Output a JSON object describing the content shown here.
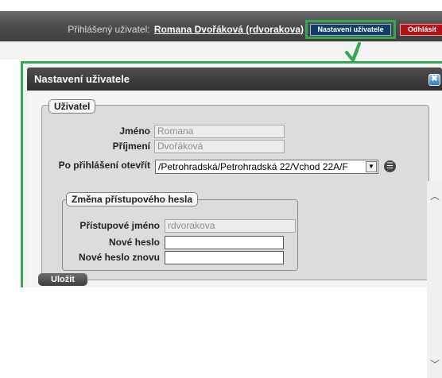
{
  "header": {
    "logged_in_label": "Přihlášený uživatel:",
    "user_display": "Romana Dvořáková (rdvorakova)",
    "settings_button": "Nastavení uživatele",
    "logout_button": "Odhlásit"
  },
  "dialog": {
    "title": "Nastavení uživatele",
    "close_icon": "close-icon",
    "user_section": {
      "legend": "Uživatel",
      "first_name_label": "Jméno",
      "first_name_value": "Romana",
      "last_name_label": "Příjmení",
      "last_name_value": "Dvořáková",
      "open_after_login_label": "Po přihlášení otevřít",
      "open_after_login_value": "/Petrohradská/Petrohradská 22/Vchod 22A/F"
    },
    "password_section": {
      "legend": "Změna přístupového hesla",
      "login_label": "Přístupové jméno",
      "login_value": "rdvorakova",
      "new_password_label": "Nové heslo",
      "new_password_value": "",
      "new_password_repeat_label": "Nové heslo znovu",
      "new_password_repeat_value": ""
    },
    "save_button": "Uložit"
  },
  "colors": {
    "highlight": "#34a853",
    "settings_button_bg": "#0f3e66",
    "logout_button_bg": "#b31217"
  }
}
